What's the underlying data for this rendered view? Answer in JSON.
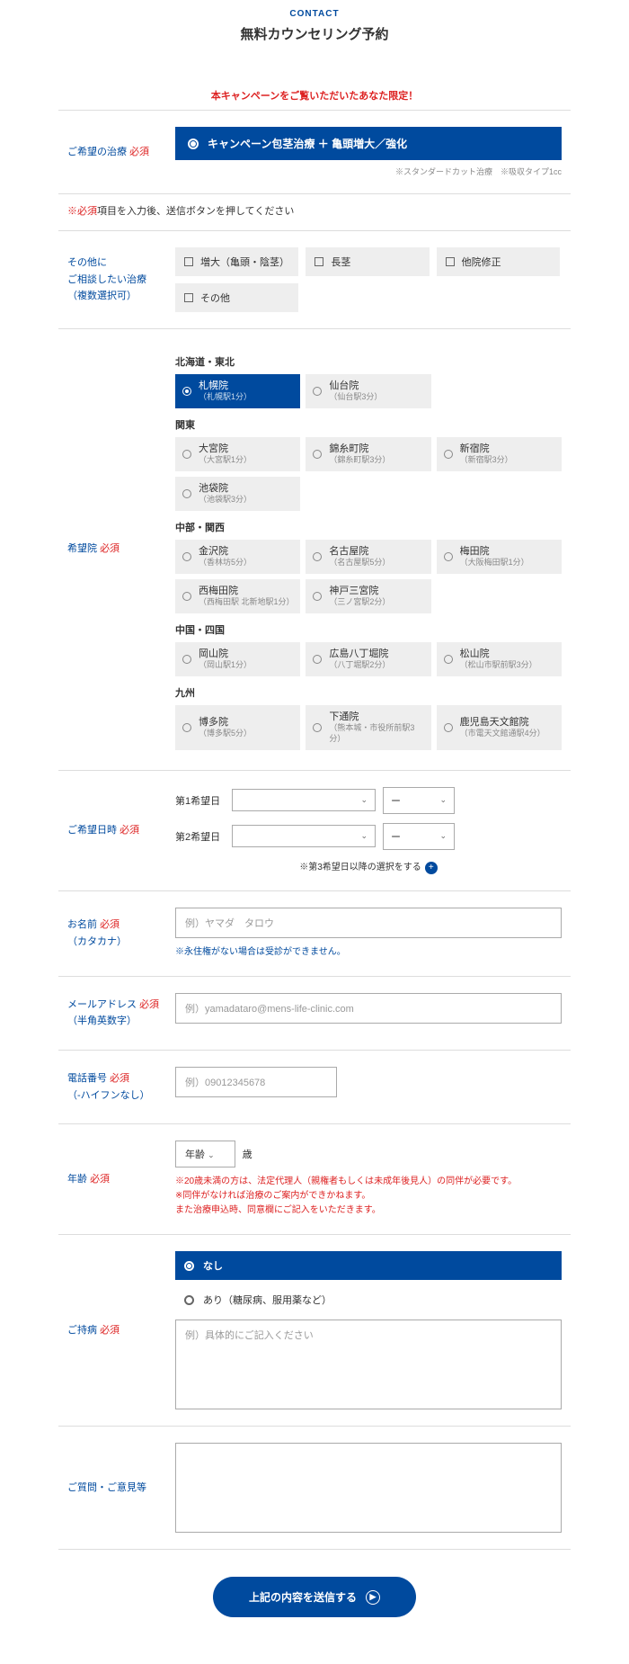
{
  "header": {
    "contact": "CONTACT",
    "title": "無料カウンセリング予約"
  },
  "campaign_note": "本キャンペーンをご覧いただいたあなた限定！",
  "required_note": {
    "mark": "※必須",
    "text": "項目を入力後、送信ボタンを押してください"
  },
  "treatment": {
    "label": "ご希望の治療",
    "req": "必須",
    "selected": "キャンペーン包茎治療 ＋ 亀頭増大／強化",
    "footnote": "※スタンダードカット治療　※吸収タイプ1cc"
  },
  "other": {
    "label1": "その他に",
    "label2": "ご相談したい治療",
    "label3": "（複数選択可）",
    "options": [
      "増大（亀頭・陰茎）",
      "長茎",
      "他院修正",
      "その他"
    ]
  },
  "clinics": {
    "label": "希望院",
    "req": "必須",
    "regions": [
      {
        "name": "北海道・東北",
        "items": [
          {
            "name": "札幌院",
            "sub": "（札幌駅1分）",
            "selected": true
          },
          {
            "name": "仙台院",
            "sub": "（仙台駅3分）"
          }
        ]
      },
      {
        "name": "関東",
        "items": [
          {
            "name": "大宮院",
            "sub": "（大宮駅1分）"
          },
          {
            "name": "錦糸町院",
            "sub": "（錦糸町駅3分）"
          },
          {
            "name": "新宿院",
            "sub": "（新宿駅3分）"
          },
          {
            "name": "池袋院",
            "sub": "（池袋駅3分）"
          }
        ]
      },
      {
        "name": "中部・関西",
        "items": [
          {
            "name": "金沢院",
            "sub": "（香林坊5分）"
          },
          {
            "name": "名古屋院",
            "sub": "（名古屋駅5分）"
          },
          {
            "name": "梅田院",
            "sub": "（大阪梅田駅1分）"
          },
          {
            "name": "西梅田院",
            "sub": "（西梅田駅 北新地駅1分）"
          },
          {
            "name": "神戸三宮院",
            "sub": "（三ノ宮駅2分）"
          }
        ]
      },
      {
        "name": "中国・四国",
        "items": [
          {
            "name": "岡山院",
            "sub": "（岡山駅1分）"
          },
          {
            "name": "広島八丁堀院",
            "sub": "（八丁堀駅2分）"
          },
          {
            "name": "松山院",
            "sub": "（松山市駅前駅3分）"
          }
        ]
      },
      {
        "name": "九州",
        "items": [
          {
            "name": "博多院",
            "sub": "（博多駅5分）"
          },
          {
            "name": "下通院",
            "sub": "（熊本城・市役所前駅3分）"
          },
          {
            "name": "鹿児島天文館院",
            "sub": "（市電天文館通駅4分）"
          }
        ]
      }
    ]
  },
  "datetime": {
    "label": "ご希望日時",
    "req": "必須",
    "row1": "第1希望日",
    "row2": "第2希望日",
    "dash": "ー",
    "add_note": "※第3希望日以降の選択をする"
  },
  "name": {
    "label": "お名前",
    "req": "必須",
    "sub": "（カタカナ）",
    "placeholder": "例）ヤマダ　タロウ",
    "help": "※永住権がない場合は受診ができません。"
  },
  "email": {
    "label": "メールアドレス",
    "req": "必須",
    "sub": "（半角英数字）",
    "placeholder": "例）yamadataro@mens-life-clinic.com"
  },
  "phone": {
    "label": "電話番号",
    "req": "必須",
    "sub": "（-ハイフンなし）",
    "placeholder": "例）09012345678"
  },
  "age": {
    "label": "年齢",
    "req": "必須",
    "select": "年齢",
    "unit": "歳",
    "help1": "※20歳未満の方は、法定代理人（親権者もしくは未成年後見人）の同伴が必要です。",
    "help2": "※同伴がなければ治療のご案内ができかねます。",
    "help3": "また治療申込時、同意欄にご記入をいただきます。"
  },
  "condition": {
    "label": "ご持病",
    "req": "必須",
    "opt_none": "なし",
    "opt_yes": "あり（糖尿病、服用薬など）",
    "placeholder": "例）具体的にご記入ください"
  },
  "comments": {
    "label": "ご質問・ご意見等"
  },
  "submit": "上記の内容を送信する"
}
